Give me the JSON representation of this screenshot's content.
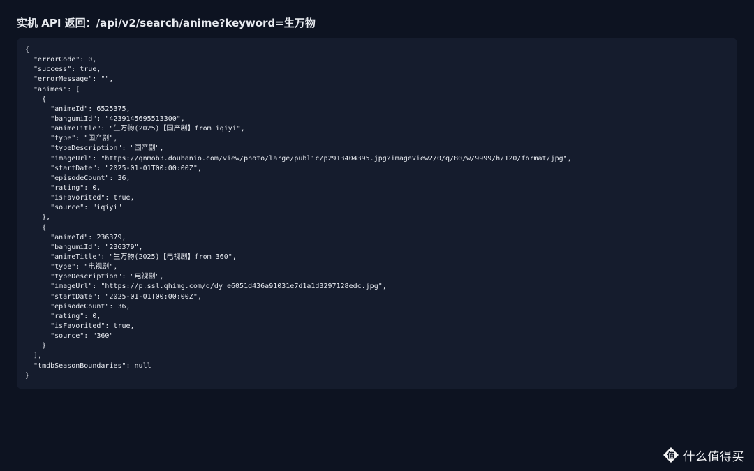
{
  "header": {
    "title": "实机 API 返回：/api/v2/search/anime?keyword=生万物"
  },
  "response": {
    "lines": [
      "{",
      "  \"errorCode\": 0,",
      "  \"success\": true,",
      "  \"errorMessage\": \"\",",
      "  \"animes\": [",
      "    {",
      "      \"animeId\": 6525375,",
      "      \"bangumiId\": \"4239145695513300\",",
      "      \"animeTitle\": \"生万物(2025)【国产剧】from iqiyi\",",
      "      \"type\": \"国产剧\",",
      "      \"typeDescription\": \"国产剧\",",
      "      \"imageUrl\": \"https://qnmob3.doubanio.com/view/photo/large/public/p2913404395.jpg?imageView2/0/q/80/w/9999/h/120/format/jpg\",",
      "      \"startDate\": \"2025-01-01T00:00:00Z\",",
      "      \"episodeCount\": 36,",
      "      \"rating\": 0,",
      "      \"isFavorited\": true,",
      "      \"source\": \"iqiyi\"",
      "    },",
      "    {",
      "      \"animeId\": 236379,",
      "      \"bangumiId\": \"236379\",",
      "      \"animeTitle\": \"生万物(2025)【电视剧】from 360\",",
      "      \"type\": \"电视剧\",",
      "      \"typeDescription\": \"电视剧\",",
      "      \"imageUrl\": \"https://p.ssl.qhimg.com/d/dy_e6051d436a91031e7d1a1d3297128edc.jpg\",",
      "      \"startDate\": \"2025-01-01T00:00:00Z\",",
      "      \"episodeCount\": 36,",
      "      \"rating\": 0,",
      "      \"isFavorited\": true,",
      "      \"source\": \"360\"",
      "    }",
      "  ],",
      "  \"tmdbSeasonBoundaries\": null",
      "}"
    ]
  },
  "watermark": {
    "text": "什么值得买",
    "logo_icon": "zhi-logo-icon",
    "logo_glyph": "值"
  },
  "colors": {
    "background": "#0d1321",
    "panel": "#151c2d",
    "text": "#e6e9ef"
  }
}
